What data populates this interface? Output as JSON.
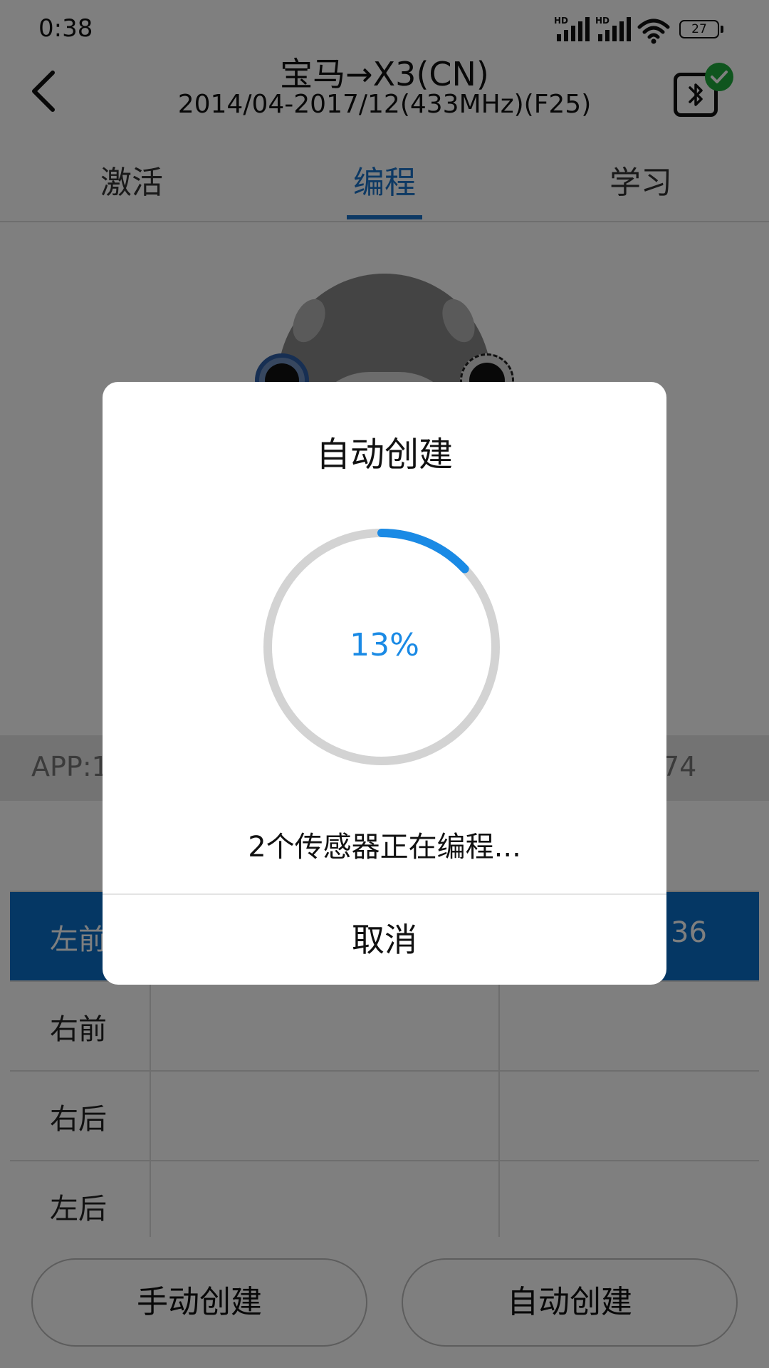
{
  "status_bar": {
    "time": "0:38",
    "network_1": "HD",
    "network_2": "HD",
    "battery": "27"
  },
  "header": {
    "title": "宝马→X3(CN)",
    "subtitle": "2014/04-2017/12(433MHz)(F25)",
    "icons": {
      "back": "chevron-left-icon",
      "bluetooth": "bluetooth-icon",
      "status": "check-icon"
    },
    "check_color": "#1faa3c"
  },
  "tabs": [
    {
      "label": "激活"
    },
    {
      "label": "编程",
      "active": true
    },
    {
      "label": "学习"
    }
  ],
  "accent_color": "#1a73c8",
  "info_row": {
    "app_version_visible": "APP:1",
    "right_value_visible": "74"
  },
  "table": {
    "rows": [
      {
        "position": "左前",
        "value": "36",
        "selected": true
      },
      {
        "position": "右前",
        "value": ""
      },
      {
        "position": "右后",
        "value": ""
      },
      {
        "position": "左后",
        "value": ""
      }
    ]
  },
  "buttons": {
    "manual_create": "手动创建",
    "auto_create": "自动创建"
  },
  "dialog": {
    "title": "自动创建",
    "progress_percent": 13,
    "progress_text": "13%",
    "message": "2个传感器正在编程...",
    "cancel": "取消",
    "progress_color": "#1a8ae5",
    "track_color": "#d3d3d3"
  }
}
